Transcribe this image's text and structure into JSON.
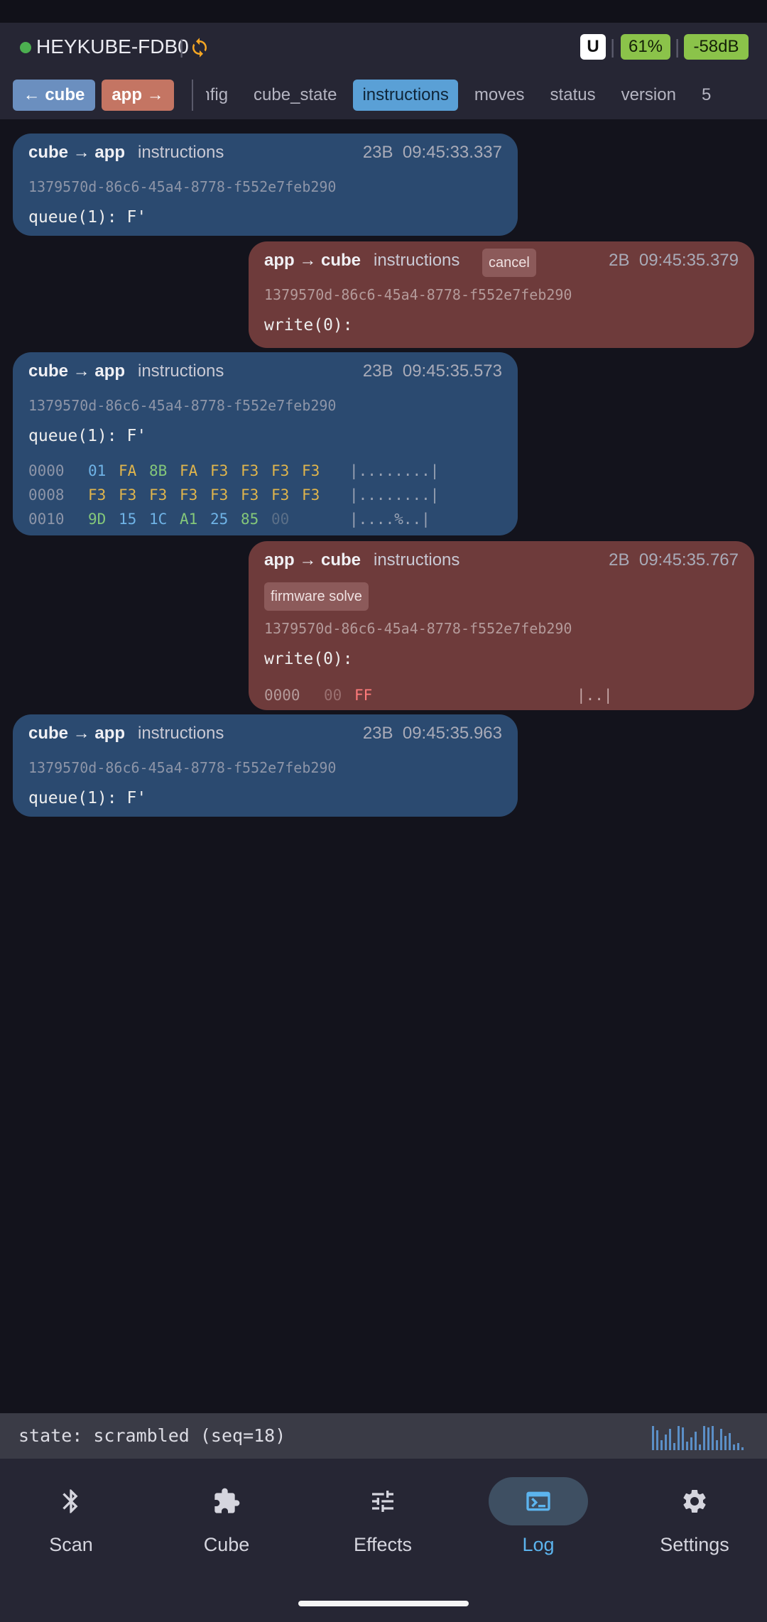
{
  "header": {
    "device_name": "HEYKUBE-FDB0",
    "separator": "|",
    "badge_u": "U",
    "battery": "61%",
    "rssi": "-58dB",
    "status_color": "#4caf50"
  },
  "filters": {
    "dir_cube": "← cube",
    "dir_app": "app →",
    "tabs": [
      "config",
      "cube_state",
      "instructions",
      "moves",
      "status",
      "version",
      "5"
    ],
    "active_tab": "instructions"
  },
  "log": [
    {
      "direction": "cube → app",
      "channel": "instructions",
      "size": "23B",
      "time": "09:45:33.337",
      "uuid": "1379570d-86c6-45a4-8778-f552e7feb290",
      "payload": "queue(1): F'"
    },
    {
      "direction": "app → cube",
      "channel": "instructions",
      "tag": "cancel",
      "size": "2B",
      "time": "09:45:35.379",
      "uuid": "1379570d-86c6-45a4-8778-f552e7feb290",
      "payload": "write(0):"
    },
    {
      "direction": "cube → app",
      "channel": "instructions",
      "size": "23B",
      "time": "09:45:35.573",
      "uuid": "1379570d-86c6-45a4-8778-f552e7feb290",
      "payload": "queue(1): F'",
      "hex": [
        {
          "offset": "0000",
          "bytes": [
            "01",
            "FA",
            "8B",
            "FA",
            "F3",
            "F3",
            "F3",
            "F3"
          ],
          "ascii": "|........|"
        },
        {
          "offset": "0008",
          "bytes": [
            "F3",
            "F3",
            "F3",
            "F3",
            "F3",
            "F3",
            "F3",
            "F3"
          ],
          "ascii": "|........|"
        },
        {
          "offset": "0010",
          "bytes": [
            "9D",
            "15",
            "1C",
            "A1",
            "25",
            "85",
            "00"
          ],
          "ascii": "|....%..|"
        }
      ]
    },
    {
      "direction": "app → cube",
      "channel": "instructions",
      "tag": "firmware solve",
      "size": "2B",
      "time": "09:45:35.767",
      "uuid": "1379570d-86c6-45a4-8778-f552e7feb290",
      "payload": "write(0):",
      "hex": [
        {
          "offset": "0000",
          "bytes": [
            "00",
            "FF"
          ],
          "ascii": "|..|"
        }
      ]
    },
    {
      "direction": "cube → app",
      "channel": "instructions",
      "size": "23B",
      "time": "09:45:35.963",
      "uuid": "1379570d-86c6-45a4-8778-f552e7feb290",
      "payload": "queue(1): F'"
    }
  ],
  "state_bar": {
    "text": "state: scrambled (seq=18)"
  },
  "nav": {
    "items": [
      {
        "label": "Scan",
        "icon": "bluetooth-icon"
      },
      {
        "label": "Cube",
        "icon": "puzzle-icon"
      },
      {
        "label": "Effects",
        "icon": "sliders-icon"
      },
      {
        "label": "Log",
        "icon": "terminal-icon"
      },
      {
        "label": "Settings",
        "icon": "gear-icon"
      }
    ],
    "active": "Log",
    "accent": "#5cb4ee"
  }
}
